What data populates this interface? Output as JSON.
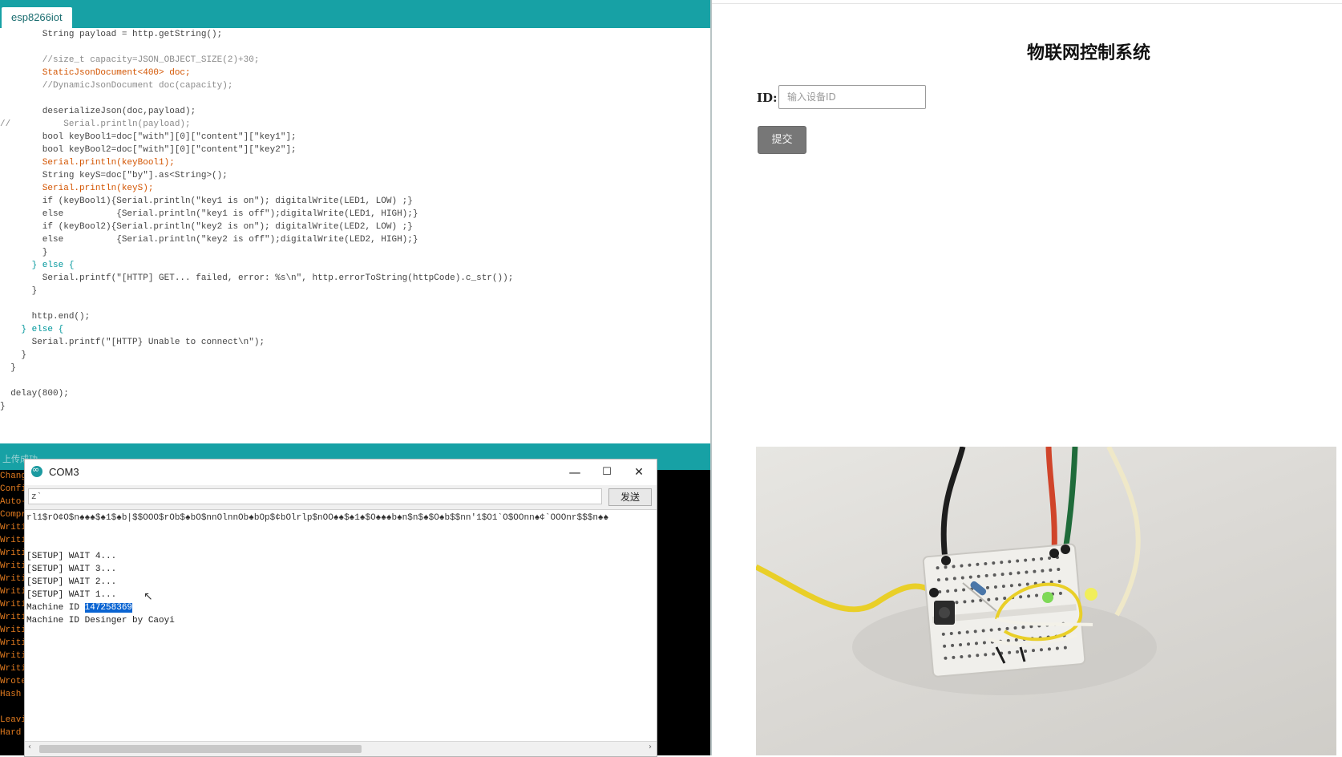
{
  "ide": {
    "tab_label": "esp8266iot",
    "status_text": "上传成功",
    "code_lines": [
      "        String payload = http.getString();",
      "",
      "        //size_t capacity=JSON_OBJECT_SIZE(2)+30;",
      "        StaticJsonDocument<400> doc;",
      "        //DynamicJsonDocument doc(capacity);",
      "",
      "        deserializeJson(doc,payload);",
      "//          Serial.println(payload);",
      "        bool keyBool1=doc[\"with\"][0][\"content\"][\"key1\"];",
      "        bool keyBool2=doc[\"with\"][0][\"content\"][\"key2\"];",
      "        Serial.println(keyBool1);",
      "        String keyS=doc[\"by\"].as<String>();",
      "        Serial.println(keyS);",
      "        if (keyBool1){Serial.println(\"key1 is on\"); digitalWrite(LED1, LOW) ;}",
      "        else          {Serial.println(\"key1 is off\");digitalWrite(LED1, HIGH);}",
      "        if (keyBool2){Serial.println(\"key2 is on\"); digitalWrite(LED2, LOW) ;}",
      "        else          {Serial.println(\"key2 is off\");digitalWrite(LED2, HIGH);}",
      "        }",
      "      } else {",
      "        Serial.printf(\"[HTTP] GET... failed, error: %s\\n\", http.errorToString(httpCode).c_str());",
      "      }",
      "",
      "      http.end();",
      "    } else {",
      "      Serial.printf(\"[HTTP} Unable to connect\\n\");",
      "    }",
      "  }",
      "",
      "  delay(800);",
      "}"
    ],
    "console_lines": [
      "Chang",
      "Confi",
      "Auto-",
      "Compr",
      "Writi",
      "Writi",
      "Writi",
      "Writi",
      "Writi",
      "Writi",
      "Writi",
      "Writi",
      "Writi",
      "Writi",
      "Writi",
      "Writi",
      "Wrote",
      "Hash ",
      "",
      "Leavi",
      "Hard "
    ]
  },
  "serial": {
    "title": "COM3",
    "minimize_icon": "—",
    "maximize_icon": "☐",
    "close_icon": "✕",
    "input_value": "z`",
    "send_label": "发送",
    "garbled_line": "rl1$rO¢O$n♠♠♠$♠1$♠b|$$OOO$rOb$♠bO$nnOlnnOb♠bOp$¢bOlrlp$nOO♠♠$♠1♠$O♠♠♠b♠n$n$♠$O♠b$$nn'1$O1`O$OOnn♠¢`OOOnr$$$n♠♠",
    "lines": [
      "[SETUP] WAIT 4...",
      "[SETUP] WAIT 3...",
      "[SETUP] WAIT 2...",
      "[SETUP] WAIT 1..."
    ],
    "machine_id_prefix": "Machine ID ",
    "machine_id": "147258369",
    "designer_line": "Machine ID Desinger by Caoyi",
    "scroll_left": "‹",
    "scroll_right": "›"
  },
  "web": {
    "title": "物联网控制系统",
    "id_label": "ID:",
    "id_placeholder": "输入设备ID",
    "submit_label": "提交"
  }
}
